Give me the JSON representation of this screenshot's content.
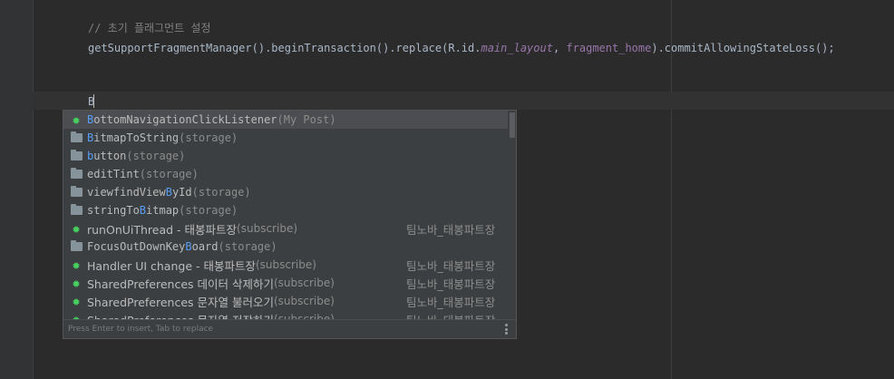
{
  "editor": {
    "comment": "// 초기 플래그먼트 설정",
    "code": {
      "part1": "getSupportFragmentManager().beginTransaction().replace(R.id.",
      "field": "main_layout",
      "part2": ", ",
      "arg": "fragment_home",
      "part3": ").commitAllowingStateLoss();"
    },
    "typed": "B"
  },
  "completion": {
    "items": [
      {
        "icon": "live-template-icon",
        "match": "B",
        "rest": "ottomNavigationClickListener",
        "loc": "(My Post)",
        "tail": ""
      },
      {
        "icon": "folder-icon",
        "match": "B",
        "rest": "itmapToString",
        "loc": "(storage)",
        "tail": ""
      },
      {
        "icon": "folder-icon",
        "match": "b",
        "rest": "utton",
        "loc": "(storage)",
        "tail": ""
      },
      {
        "icon": "folder-icon",
        "pre": "editTint",
        "loc": "(storage)",
        "tail": ""
      },
      {
        "icon": "folder-icon",
        "pre": "viewfindView",
        "match": "B",
        "rest": "yId",
        "loc": "(storage)",
        "tail": ""
      },
      {
        "icon": "folder-icon",
        "pre": "stringTo",
        "match": "B",
        "rest": "itmap",
        "loc": "(storage)",
        "tail": ""
      },
      {
        "icon": "live-template-icon",
        "pre": "runOnUiThread - 태봉파트장",
        "loc": "(subscribe)",
        "tail": "팀노바_태봉파트장"
      },
      {
        "icon": "folder-icon",
        "pre": "FocusOutDownKey",
        "match": "B",
        "rest": "oard",
        "loc": "(storage)",
        "tail": ""
      },
      {
        "icon": "live-template-icon",
        "pre": "Handler UI change - 태봉파트장",
        "loc": "(subscribe)",
        "tail": "팀노바_태봉파트장"
      },
      {
        "icon": "live-template-icon",
        "pre": "SharedPreferences 데이터 삭제하기",
        "loc": "(subscribe)",
        "tail": "팀노바_태봉파트장"
      },
      {
        "icon": "live-template-icon",
        "pre": "SharedPreferences 문자열 불러오기",
        "loc": "(subscribe)",
        "tail": "팀노바_태봉파트장"
      },
      {
        "icon": "live-template-icon",
        "pre": "SharedPreferences 문자열 저장하기",
        "loc": "(subscribe)",
        "tail": "팀노바_태봉파트장"
      }
    ],
    "footer": "Press Enter to insert, Tab to replace"
  },
  "colors": {
    "background": "#2b2b2b",
    "popup": "#3c3f41",
    "match": "#589df6",
    "live_template": "#46d160"
  }
}
